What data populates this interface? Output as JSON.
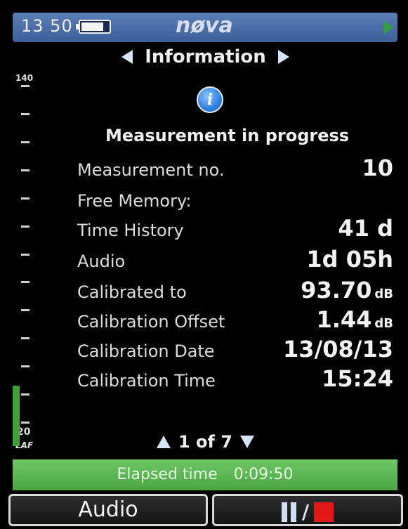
{
  "status_bar": {
    "time": "13 50",
    "battery_level": 0.82,
    "brand": "nøva",
    "run_state_icon": "play-icon"
  },
  "page": {
    "title": "Information",
    "prev_icon": "triangle-left-icon",
    "next_icon": "triangle-right-icon",
    "info_icon": "info-icon",
    "info_glyph": "i"
  },
  "meter": {
    "top_label": "140",
    "bottom_label": "20",
    "unit": "LAF",
    "range": [
      20,
      140
    ],
    "current_level": 40,
    "bar_color": "#3fa236"
  },
  "info": {
    "heading": "Measurement in progress",
    "rows": [
      {
        "label": "Measurement no.",
        "value": "10",
        "unit": ""
      },
      {
        "label": "Free Memory:",
        "value": "",
        "unit": ""
      },
      {
        "label": "Time History",
        "value": "41 d",
        "unit": ""
      },
      {
        "label": "Audio",
        "value": "1d 05h",
        "unit": ""
      },
      {
        "label": "Calibrated to",
        "value": "93.70",
        "unit": "dB"
      },
      {
        "label": "Calibration Offset",
        "value": "1.44",
        "unit": "dB"
      },
      {
        "label": "Calibration Date",
        "value": "13/08/13",
        "unit": ""
      },
      {
        "label": "Calibration Time",
        "value": "15:24",
        "unit": ""
      }
    ]
  },
  "pager": {
    "text": "1 of 7",
    "up_icon": "triangle-up-icon",
    "down_icon": "triangle-down-icon"
  },
  "elapsed": {
    "label": "Elapsed time",
    "value": "0:09:50",
    "color": "#49a642"
  },
  "softkeys": {
    "left_label": "Audio",
    "right_slash": "/",
    "right_icons": [
      "pause-icon",
      "stop-icon"
    ]
  },
  "colors": {
    "status_bar": "#3d5f98",
    "stop": "#e01818",
    "run": "#2ea043"
  }
}
